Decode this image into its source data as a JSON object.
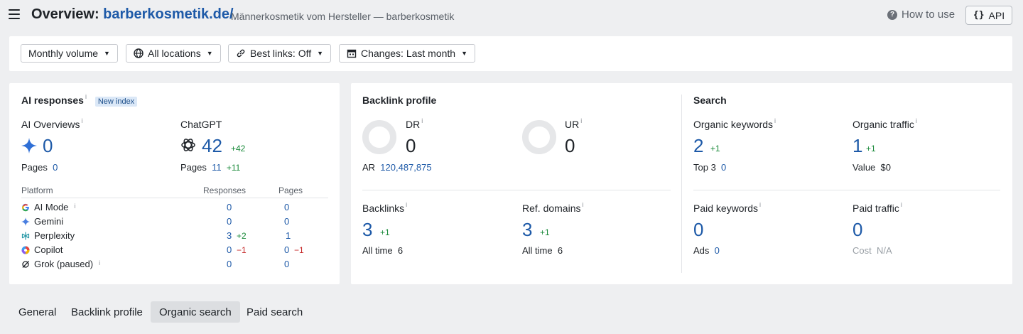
{
  "header": {
    "title_prefix": "Overview: ",
    "domain": "barberkosmetik.de/",
    "subtitle": "Männerkosmetik vom Hersteller — barberkosmetik",
    "how_to_use": "How to use",
    "api_label": "API",
    "api_glyph": "{}"
  },
  "filters": {
    "volume": "Monthly volume",
    "locations": "All locations",
    "best_links": "Best links: Off",
    "changes": "Changes: Last month"
  },
  "ai": {
    "title": "AI responses",
    "badge": "New index",
    "overviews": {
      "label": "AI Overviews",
      "value": "0",
      "pages_label": "Pages",
      "pages": "0"
    },
    "chatgpt": {
      "label": "ChatGPT",
      "value": "42",
      "delta": "+42",
      "pages_label": "Pages",
      "pages": "11",
      "pages_delta": "+11"
    },
    "table": {
      "headers": [
        "Platform",
        "Responses",
        "Pages"
      ],
      "rows": [
        {
          "name": "AI Mode",
          "responses": "0",
          "resp_delta": "",
          "pages": "0",
          "pages_delta": ""
        },
        {
          "name": "Gemini",
          "responses": "0",
          "resp_delta": "",
          "pages": "0",
          "pages_delta": ""
        },
        {
          "name": "Perplexity",
          "responses": "3",
          "resp_delta": "+2",
          "pages": "1",
          "pages_delta": ""
        },
        {
          "name": "Copilot",
          "responses": "0",
          "resp_delta": "−1",
          "pages": "0",
          "pages_delta": "−1"
        },
        {
          "name": "Grok (paused)",
          "responses": "0",
          "resp_delta": "",
          "pages": "0",
          "pages_delta": ""
        }
      ]
    }
  },
  "backlink": {
    "title": "Backlink profile",
    "dr": {
      "label": "DR",
      "value": "0",
      "ar_label": "AR",
      "ar": "120,487,875"
    },
    "ur": {
      "label": "UR",
      "value": "0"
    },
    "backlinks": {
      "label": "Backlinks",
      "value": "3",
      "delta": "+1",
      "sub_label": "All time",
      "sub": "6"
    },
    "ref_domains": {
      "label": "Ref. domains",
      "value": "3",
      "delta": "+1",
      "sub_label": "All time",
      "sub": "6"
    }
  },
  "search": {
    "title": "Search",
    "organic_keywords": {
      "label": "Organic keywords",
      "value": "2",
      "delta": "+1",
      "sub_label": "Top 3",
      "sub": "0"
    },
    "organic_traffic": {
      "label": "Organic traffic",
      "value": "1",
      "delta": "+1",
      "sub_label": "Value",
      "sub": "$0"
    },
    "paid_keywords": {
      "label": "Paid keywords",
      "value": "0",
      "sub_label": "Ads",
      "sub": "0"
    },
    "paid_traffic": {
      "label": "Paid traffic",
      "value": "0",
      "sub_label": "Cost",
      "sub": "N/A"
    }
  },
  "tabs": [
    "General",
    "Backlink profile",
    "Organic search",
    "Paid search"
  ],
  "active_tab": "Organic search",
  "colors": {
    "accent": "#1e5aa8",
    "positive": "#1a8a3a",
    "negative": "#c62828"
  }
}
